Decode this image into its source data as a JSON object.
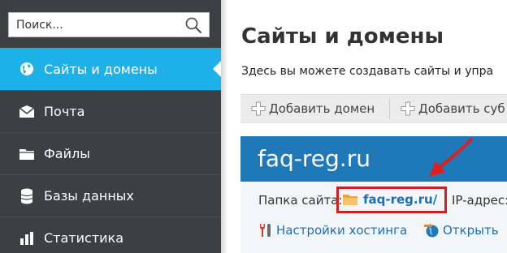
{
  "sidebar": {
    "search": {
      "placeholder": "Поиск..."
    },
    "items": [
      {
        "label": "Сайты и домены",
        "icon": "globe-icon",
        "active": true
      },
      {
        "label": "Почта",
        "icon": "mail-icon",
        "active": false
      },
      {
        "label": "Файлы",
        "icon": "folder-icon",
        "active": false
      },
      {
        "label": "Базы данных",
        "icon": "database-icon",
        "active": false
      },
      {
        "label": "Статистика",
        "icon": "chart-icon",
        "active": false
      }
    ]
  },
  "main": {
    "title": "Сайты и домены",
    "description": "Здесь вы можете создавать сайты и упра",
    "toolbar": {
      "add_domain": "Добавить домен",
      "add_subdomain": "Добавить суб"
    },
    "domain": {
      "name": "faq-reg.ru",
      "folder_label": "Папка сайта:",
      "folder_link": "faq-reg.ru/",
      "ip_label": "IP-адрес:",
      "hosting_settings": "Настройки хостинга",
      "open": "Открыть"
    }
  },
  "colors": {
    "sidebar_bg": "#3c4043",
    "active_item": "#1eb1e7",
    "domain_header": "#1f78b8",
    "link": "#1f6db3",
    "highlight": "#d01f1f"
  }
}
